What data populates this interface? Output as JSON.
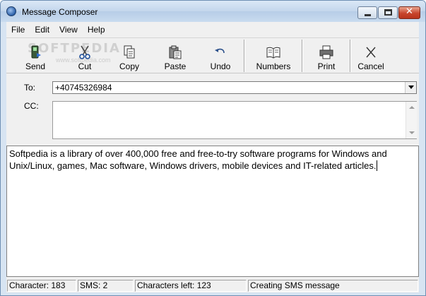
{
  "window": {
    "title": "Message Composer",
    "app_icon": "globe-icon"
  },
  "menu": {
    "items": [
      "File",
      "Edit",
      "View",
      "Help"
    ]
  },
  "toolbar": {
    "watermark": "SOFTPEDIA",
    "watermark_sub": "www.softpedia.com",
    "buttons": [
      {
        "label": "Send",
        "icon": "send-phone-icon"
      },
      {
        "label": "Cut",
        "icon": "scissors-icon"
      },
      {
        "label": "Copy",
        "icon": "copy-icon"
      },
      {
        "label": "Paste",
        "icon": "paste-icon"
      },
      {
        "label": "Undo",
        "icon": "undo-icon"
      },
      {
        "label": "Numbers",
        "icon": "book-icon"
      },
      {
        "label": "Print",
        "icon": "printer-icon"
      },
      {
        "label": "Cancel",
        "icon": "cancel-x-icon"
      }
    ]
  },
  "address": {
    "to_label": "To:",
    "to_value": "+40745326984",
    "cc_label": "CC:",
    "cc_value": ""
  },
  "message": {
    "text": "Softpedia is a library of over 400,000 free and free-to-try software programs for Windows and Unix/Linux, games, Mac software, Windows drivers, mobile devices and IT-related articles."
  },
  "status": {
    "characters": "Character: 183",
    "sms": "SMS: 2",
    "characters_left": "Characters left: 123",
    "state": "Creating SMS message"
  }
}
